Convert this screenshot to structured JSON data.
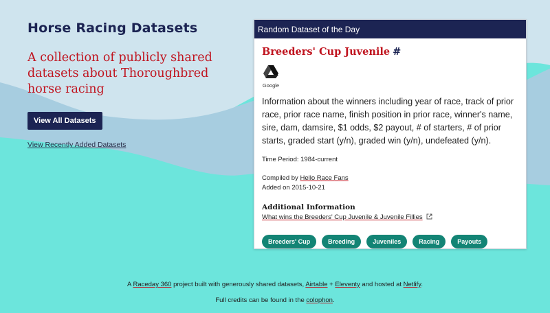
{
  "site": {
    "title": "Horse Racing Datasets",
    "tagline": "A collection of publicly shared datasets about Thoroughbred horse racing",
    "view_all_label": "View All Datasets",
    "recent_label": "View Recently Added Datasets"
  },
  "card": {
    "header": "Random Dataset of the Day",
    "title": "Breeders' Cup Juvenile",
    "anchor": "#",
    "source_icon": "google-drive-icon",
    "source_label": "Google",
    "description": "Information about the winners including year of race, track of prior race, prior race name, finish position in prior race, winner's name, sire, dam, damsire, $1 odds, $2 payout, # of starters, # of prior starts, graded start (y/n), graded win (y/n), undefeated (y/n).",
    "time_period": "Time Period: 1984-current",
    "compiled_prefix": "Compiled by ",
    "compiled_by": "Hello Race Fans",
    "added": "Added on 2015-10-21",
    "additional_title": "Additional Information",
    "additional_link": "What wins the Breeders' Cup Juvenile & Juvenile Fillies",
    "tags": [
      "Breeders' Cup",
      "Breeding",
      "Juveniles",
      "Racing",
      "Payouts"
    ]
  },
  "footer": {
    "line1": {
      "a": "A ",
      "raceday": "Raceday 360",
      "b": " project built with generously shared datasets, ",
      "airtable": "Airtable",
      "c": " + ",
      "eleventy": "Eleventy",
      "d": " and hosted at ",
      "netlify": "Netlify",
      "e": "."
    },
    "line2": {
      "a": "Full credits can be found in the ",
      "colophon": "colophon",
      "b": "."
    }
  },
  "colors": {
    "navy": "#1c2453",
    "red": "#c0141f",
    "teal_tag": "#138475",
    "turquoise_bg": "#6ce5dc",
    "sky": "#cfe4ee",
    "hills": "#a7cde0"
  }
}
